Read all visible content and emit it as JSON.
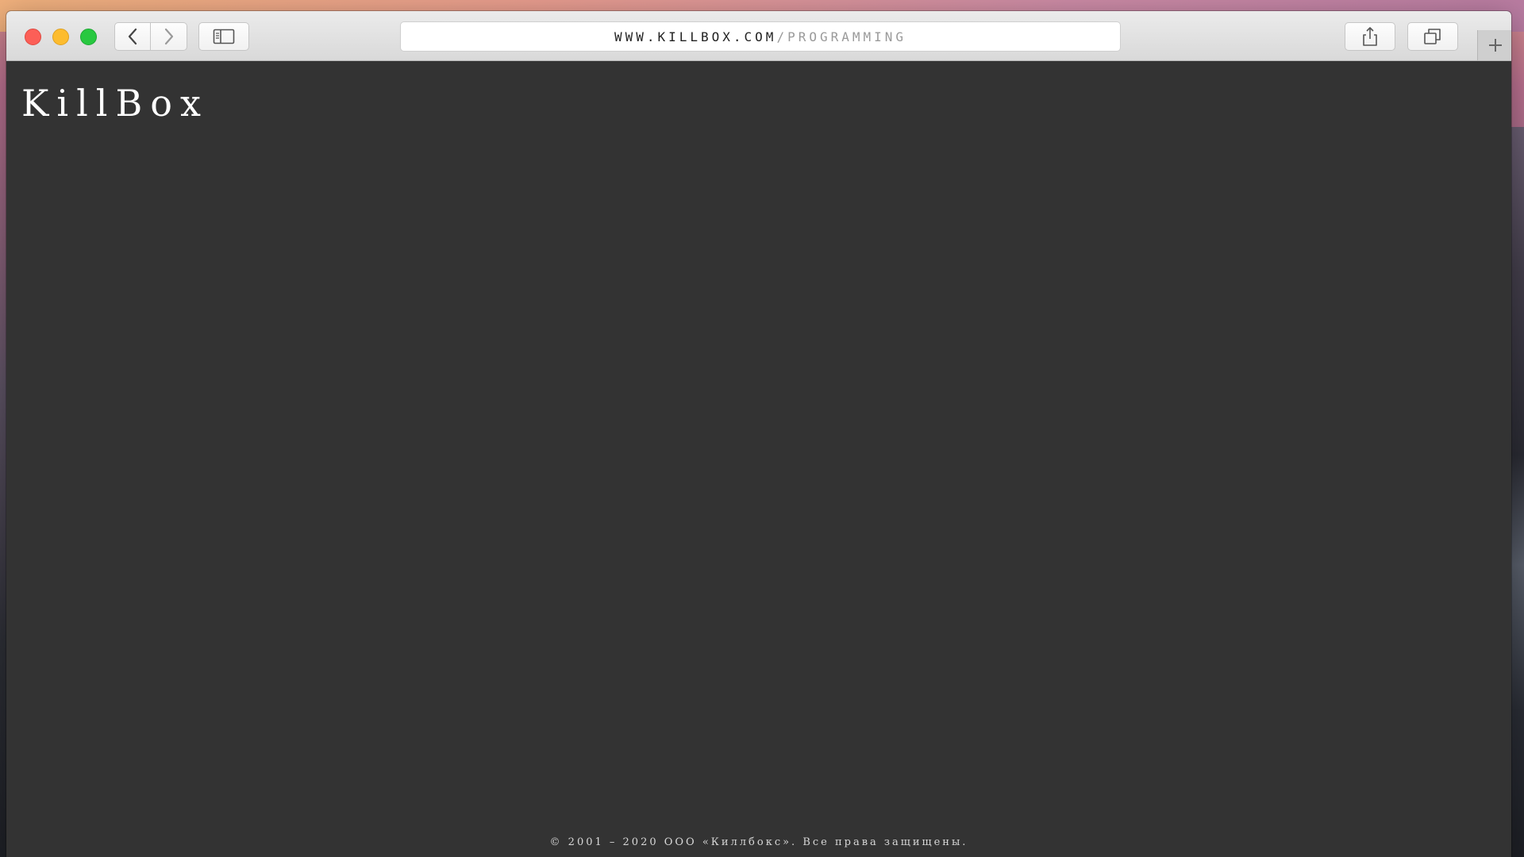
{
  "browser": {
    "address": {
      "domain": "WWW.KILLBOX.COM",
      "separator": "/",
      "path": "PROGRAMMING"
    },
    "icons": {
      "close": "close-button",
      "minimize": "minimize-button",
      "zoom": "zoom-button",
      "back": "chevron-left-icon",
      "forward": "chevron-right-icon",
      "sidebar": "sidebar-icon",
      "share": "share-icon",
      "tabs": "tabs-overview-icon",
      "new_tab": "plus-icon"
    }
  },
  "page": {
    "logo": "KillBox",
    "footer": "© 2001 – 2020 ООО «Киллбокс». Все права защищены."
  },
  "colors": {
    "page_background": "#333333",
    "logo_text": "#ffffff",
    "traffic_close": "#fc5f57",
    "traffic_minimize": "#fdbc2e",
    "traffic_zoom": "#28c840"
  }
}
